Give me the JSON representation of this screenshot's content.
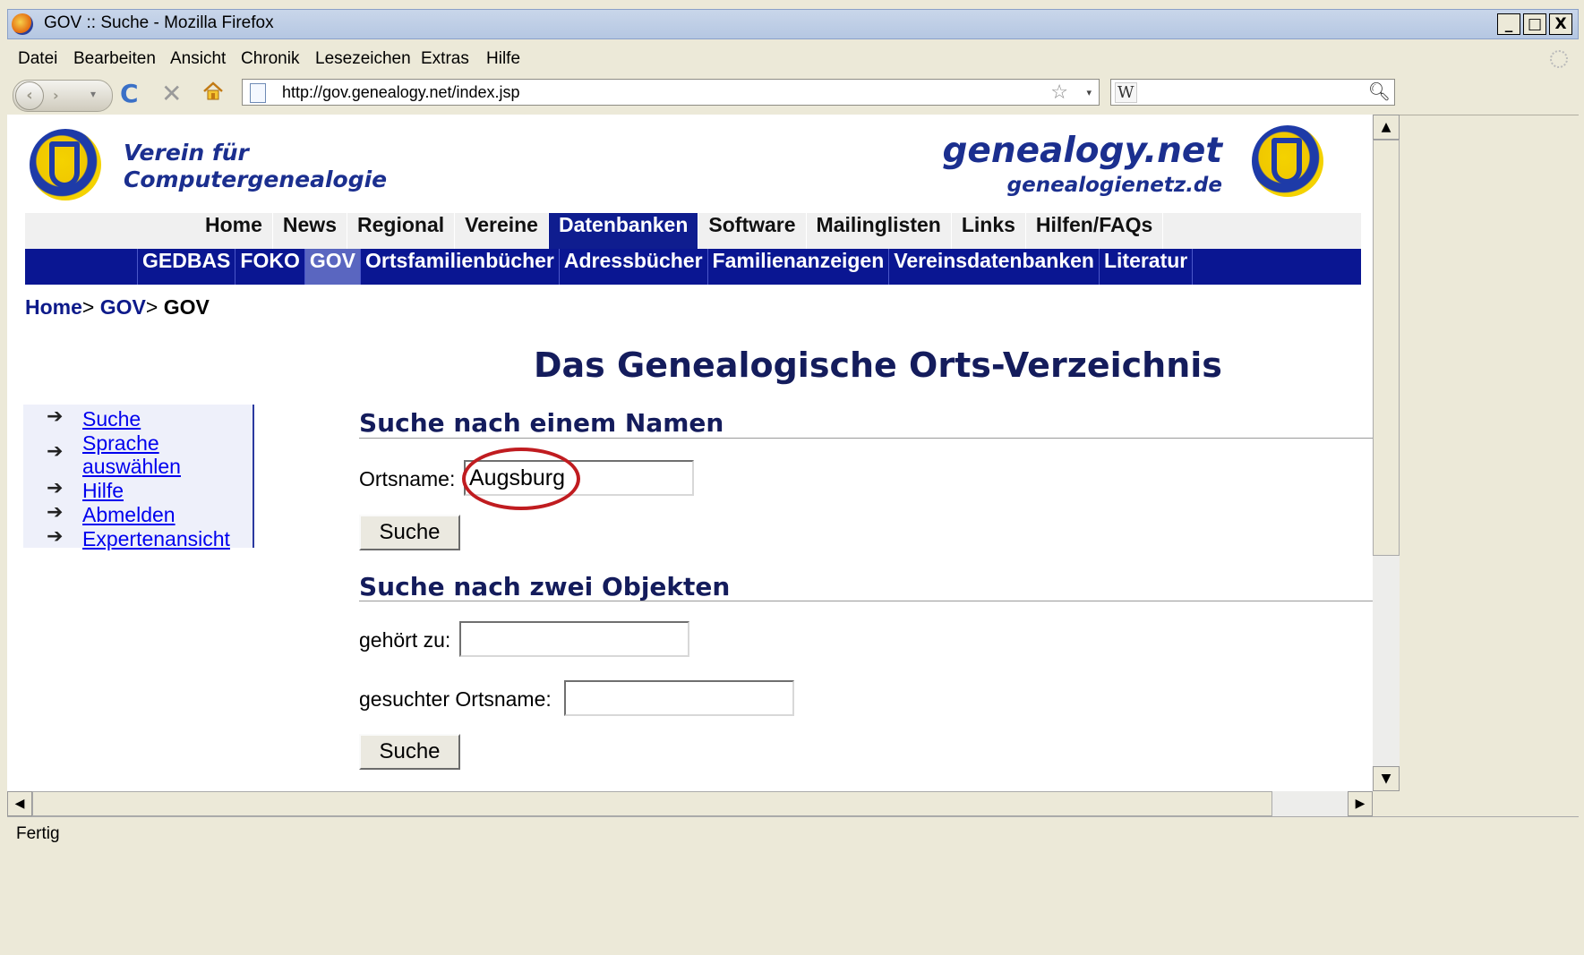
{
  "window": {
    "title": "GOV :: Suche - Mozilla Firefox",
    "buttons": [
      "_",
      "□",
      "X"
    ]
  },
  "menu": [
    "Datei",
    "Bearbeiten",
    "Ansicht",
    "Chronik",
    "Lesezeichen",
    "Extras",
    "Hilfe"
  ],
  "toolbar": {
    "url": "http://gov.genealogy.net/index.jsp",
    "search_engine": "W",
    "search_value": ""
  },
  "header": {
    "left_line1": "Verein für",
    "left_line2": "Computergenealogie",
    "right_line1": "genealogy.net",
    "right_line2": "genealogienetz.de"
  },
  "mainnav": [
    "Home",
    "News",
    "Regional",
    "Vereine",
    "Datenbanken",
    "Software",
    "Mailinglisten",
    "Links",
    "Hilfen/FAQs"
  ],
  "mainnav_active": "Datenbanken",
  "subnav": [
    "GEDBAS",
    "FOKO",
    "GOV",
    "Ortsfamilienbücher",
    "Adressbücher",
    "Familienanzeigen",
    "Vereinsdatenbanken",
    "Literatur"
  ],
  "subnav_active": "GOV",
  "breadcrumb": {
    "home": "Home",
    "sep": ">",
    "gov": "GOV",
    "current": "GOV"
  },
  "page_title": "Das Genealogische Orts-Verzeichnis",
  "sidebar": [
    {
      "label": "Suche"
    },
    {
      "label": "Sprache"
    },
    {
      "label": "auswählen"
    },
    {
      "label": "Hilfe"
    },
    {
      "label": "Abmelden"
    },
    {
      "label": "Expertenansicht"
    }
  ],
  "section1": {
    "heading": "Suche nach einem Namen",
    "label": "Ortsname:",
    "value": "Augsburg",
    "button": "Suche"
  },
  "section2": {
    "heading": "Suche nach zwei Objekten",
    "label1": "gehört zu:",
    "value1": "",
    "label2": "gesuchter Ortsname:",
    "value2": "",
    "button": "Suche"
  },
  "status": "Fertig",
  "colors": {
    "brand_navy": "#0a1692",
    "heading": "#141c5c",
    "highlight_ring": "#c01c20"
  }
}
